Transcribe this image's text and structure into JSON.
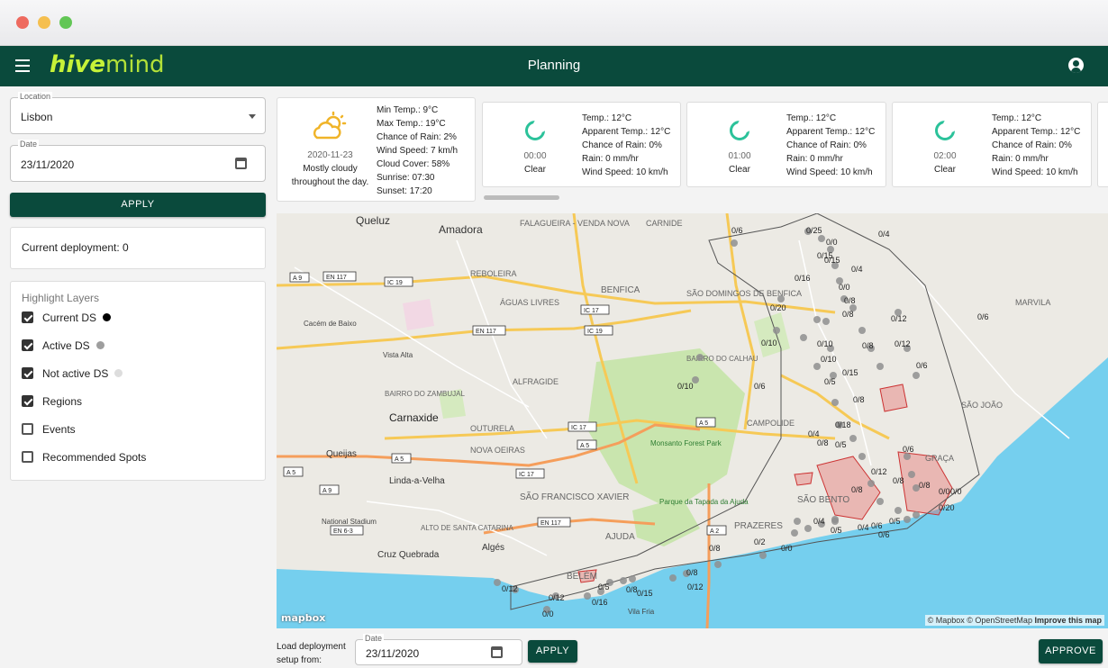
{
  "app": {
    "logo_a": "hive",
    "logo_b": "mind",
    "title": "Planning"
  },
  "sidebar": {
    "location": {
      "label": "Location",
      "value": "Lisbon"
    },
    "date": {
      "label": "Date",
      "value": "23/11/2020"
    },
    "apply_label": "APPLY",
    "current_deployment": "Current deployment: 0",
    "layers_title": "Highlight Layers",
    "layers": [
      {
        "label": "Current DS",
        "checked": true,
        "dot": "#000000"
      },
      {
        "label": "Active DS",
        "checked": true,
        "dot": "#9e9e9e"
      },
      {
        "label": "Not active DS",
        "checked": true,
        "dot": "#dddddd"
      },
      {
        "label": "Regions",
        "checked": true
      },
      {
        "label": "Events",
        "checked": false
      },
      {
        "label": "Recommended Spots",
        "checked": false
      }
    ]
  },
  "weather": {
    "summary": {
      "date": "2020-11-23",
      "desc1": "Mostly cloudy",
      "desc2": "throughout the day.",
      "icon": "partly-cloudy-day-icon",
      "lines": [
        "Min Temp.: 9°C",
        "Max Temp.: 19°C",
        "Chance of Rain: 2%",
        "Wind Speed: 7 km/h",
        "Cloud Cover: 58%",
        "Sunrise: 07:30",
        "Sunset: 17:20"
      ]
    },
    "hours": [
      {
        "time": "00:00",
        "cond": "Clear",
        "lines": [
          "Temp.: 12°C",
          "Apparent Temp.: 12°C",
          "Chance of Rain: 0%",
          "Rain: 0 mm/hr",
          "Wind Speed: 10 km/h"
        ]
      },
      {
        "time": "01:00",
        "cond": "Clear",
        "lines": [
          "Temp.: 12°C",
          "Apparent Temp.: 12°C",
          "Chance of Rain: 0%",
          "Rain: 0 mm/hr",
          "Wind Speed: 10 km/h"
        ]
      },
      {
        "time": "02:00",
        "cond": "Clear",
        "lines": [
          "Temp.: 12°C",
          "Apparent Temp.: 12°C",
          "Chance of Rain: 0%",
          "Rain: 0 mm/hr",
          "Wind Speed: 10 km/h"
        ]
      }
    ]
  },
  "map": {
    "places": [
      "Queluz",
      "Amadora",
      "FALAGUEIRA - VENDA NOVA",
      "CARNIDE",
      "REBOLEIRA",
      "ÁGUAS LIVRES",
      "BENFICA",
      "SÃO DOMINGOS DE BENFICA",
      "MARVILA",
      "Cacém de Baixo",
      "Vista Alta",
      "ALFRAGIDE",
      "CAMPOLIDE",
      "SÃO JOÃO",
      "Carnaxide",
      "OUTURELA",
      "Monsanto Forest Park",
      "Queijas",
      "NOVA OEIRAS",
      "Linda-a-Velha",
      "SÃO BENTO",
      "SÃO FRANCISCO XAVIER",
      "Parque da Tapada da Ajuda",
      "PRAZERES",
      "National Stadium",
      "ALTO DE SANTA CATARINA",
      "AJUDA",
      "Algés",
      "Cruz Quebrada",
      "BELÉM",
      "BAIRRO DO ZAMBUJAL",
      "BAIRRO DO CALHAU",
      "GRAÇA",
      "Vila Fria"
    ],
    "roads": [
      "A 9",
      "EN 117",
      "IC 19",
      "IC 17",
      "IC 19",
      "EN 117",
      "A 5",
      "IC 17",
      "A 5",
      "A 9",
      "A 5",
      "IC 17",
      "EN 117",
      "EN 6-3",
      "A 2",
      "A 5"
    ],
    "labels": [
      "0/6",
      "0/25",
      "0/0",
      "0/4",
      "0/15",
      "0/15",
      "0/4",
      "0/16",
      "0/0",
      "0/8",
      "0/20",
      "0/12",
      "0/8",
      "0/6",
      "0/10",
      "0/12",
      "0/10",
      "0/8",
      "0/10",
      "0/6",
      "0/10",
      "0/15",
      "0/5",
      "0/8",
      "0/6",
      "0/18",
      "0/4",
      "0/8",
      "0/5",
      "0/12",
      "0/6",
      "0/8",
      "0/20",
      "0/0",
      "0/4",
      "0/5",
      "0/4",
      "0/6",
      "0/2",
      "0/8",
      "0/0",
      "0/8",
      "0/12",
      "0/15",
      "0/8",
      "0/5",
      "0/16",
      "0/12",
      "0/12",
      "0/0",
      "0/5",
      "0/6",
      "0/0",
      "0/8",
      "0/8"
    ],
    "attribution": "© Mapbox © OpenStreetMap",
    "improve": "Improve this map",
    "mapbox_logo": "mapbox"
  },
  "footer": {
    "load_label_1": "Load deployment",
    "load_label_2": "setup from:",
    "date_label": "Date",
    "date_value": "23/11/2020",
    "apply_label": "APPLY",
    "approve_label": "APPROVE"
  }
}
